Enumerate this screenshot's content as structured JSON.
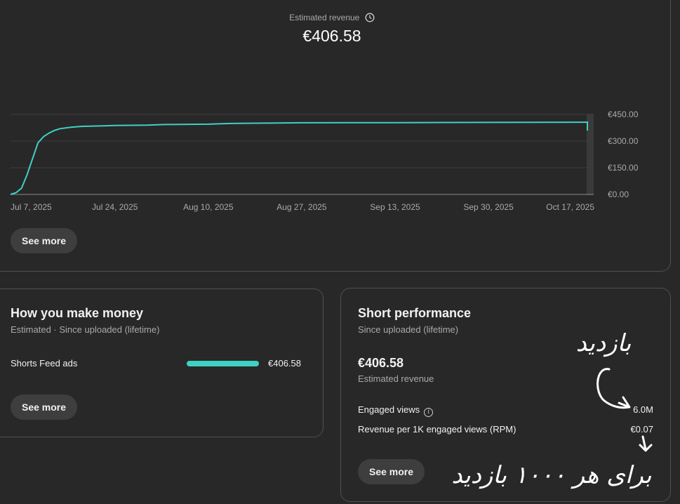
{
  "revenue": {
    "label": "Estimated revenue",
    "value": "€406.58",
    "see_more": "See more"
  },
  "chart_data": {
    "type": "line",
    "x": [
      "2025-07-05",
      "2025-07-06",
      "2025-07-07",
      "2025-07-08",
      "2025-07-09",
      "2025-07-10",
      "2025-07-11",
      "2025-07-12",
      "2025-07-13",
      "2025-07-14",
      "2025-07-16",
      "2025-07-18",
      "2025-07-22",
      "2025-07-24",
      "2025-07-30",
      "2025-08-02",
      "2025-08-10",
      "2025-08-14",
      "2025-08-20",
      "2025-08-27",
      "2025-09-13",
      "2025-09-30",
      "2025-10-17",
      "2025-10-18"
    ],
    "values": [
      0,
      10,
      35,
      110,
      200,
      290,
      325,
      345,
      360,
      370,
      378,
      383,
      386,
      388,
      390,
      393,
      395,
      399,
      401,
      403,
      404,
      405,
      406,
      406.58
    ],
    "x_ticks": [
      "Jul 7, 2025",
      "Jul 24, 2025",
      "Aug 10, 2025",
      "Aug 27, 2025",
      "Sep 13, 2025",
      "Sep 30, 2025",
      "Oct 17, 2025"
    ],
    "y_ticks": [
      "€450.00",
      "€300.00",
      "€150.00",
      "€0.00"
    ],
    "ylim": [
      0,
      450
    ],
    "color": "#3ed1c4"
  },
  "money": {
    "title": "How you make money",
    "subtitle": "Estimated · Since uploaded (lifetime)",
    "row_label": "Shorts Feed ads",
    "row_value": "€406.58",
    "row_share": 1.0,
    "see_more": "See more"
  },
  "shorts": {
    "title": "Short performance",
    "subtitle": "Since uploaded (lifetime)",
    "big_value": "€406.58",
    "big_label": "Estimated revenue",
    "engaged_label": "Engaged views",
    "engaged_value": "6.0M",
    "rpm_label": "Revenue per 1K engaged views (RPM)",
    "rpm_value": "€0.07",
    "see_more": "See more"
  },
  "annotations": {
    "note_top": "بازدید",
    "note_bottom": "برای هر ۱۰۰۰ بازدید",
    "ink_color": "#ffffff"
  }
}
